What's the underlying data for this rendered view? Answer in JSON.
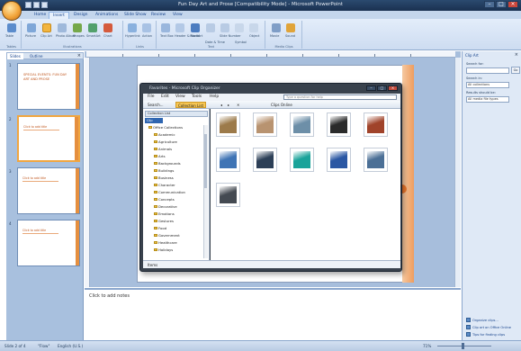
{
  "app": {
    "title": "Fun Day Art and Prose [Compatibility Mode] - Microsoft PowerPoint",
    "window_controls": [
      "–",
      "□",
      "×"
    ]
  },
  "ribbon": {
    "tabs": [
      "Home",
      "Insert",
      "Design",
      "Animations",
      "Slide Show",
      "Review",
      "View"
    ],
    "active_tab": "Insert",
    "groups": [
      {
        "name": "Tables",
        "buttons": [
          "Table"
        ]
      },
      {
        "name": "Illustrations",
        "buttons": [
          "Picture",
          "Clip Art",
          "Photo Album",
          "Shapes",
          "SmartArt",
          "Chart"
        ]
      },
      {
        "name": "Links",
        "buttons": [
          "Hyperlink",
          "Action"
        ]
      },
      {
        "name": "Text",
        "buttons": [
          "Text Box",
          "Header & Footer",
          "WordArt",
          "Date & Time",
          "Slide Number",
          "Symbol",
          "Object"
        ]
      },
      {
        "name": "Media Clips",
        "buttons": [
          "Movie",
          "Sound"
        ]
      }
    ]
  },
  "slides_pane": {
    "tabs": [
      "Slides",
      "Outline"
    ],
    "close": "×",
    "thumbnails": [
      {
        "num": "1",
        "text": "SPECIAL EVENTS: FUN DAY ART AND PROSE",
        "selected": false
      },
      {
        "num": "2",
        "text": "Click to add title",
        "selected": true
      },
      {
        "num": "3",
        "text": "Click to add title",
        "selected": false
      },
      {
        "num": "4",
        "text": "Click to add title",
        "selected": false
      }
    ]
  },
  "notes": {
    "placeholder": "Click to add notes"
  },
  "clip_organizer": {
    "title": "Favorites - Microsoft Clip Organizer",
    "menu": [
      "File",
      "Edit",
      "View",
      "Tools",
      "Help"
    ],
    "search_placeholder": "Type a question for help",
    "toolbar": [
      "Search...",
      "Collection List",
      "Clips Online"
    ],
    "tree_header": "Collection List",
    "tree_tab": "Clip",
    "tree_items": [
      "Office Collections",
      "Academic",
      "Agriculture",
      "Animals",
      "Arts",
      "Backgrounds",
      "Buildings",
      "Business",
      "Character",
      "Communication",
      "Concepts",
      "Decorative",
      "Emotions",
      "Gestures",
      "Food",
      "Government",
      "Healthcare",
      "Holidays"
    ],
    "clips": [
      {
        "name": "landmark clip",
        "color": "#9c7a4a"
      },
      {
        "name": "sculpture clip",
        "color": "#b89370"
      },
      {
        "name": "tower clip",
        "color": "#6d8fa8"
      },
      {
        "name": "dark building clip",
        "color": "#2b2b2b"
      },
      {
        "name": "pagoda clip",
        "color": "#a0432a"
      },
      {
        "name": "house clip",
        "color": "#3f74b5"
      },
      {
        "name": "lighthouse clip",
        "color": "#2c3f57"
      },
      {
        "name": "teal building clip",
        "color": "#1aa39a"
      },
      {
        "name": "blue houses clip",
        "color": "#2a57a3"
      },
      {
        "name": "city clip",
        "color": "#4b6f96"
      },
      {
        "name": "bus clip",
        "color": "#444a52"
      }
    ],
    "status": "Items",
    "window_controls": [
      "–",
      "□",
      "×"
    ]
  },
  "task_pane": {
    "title": "Clip Art",
    "close": "×",
    "search_label": "Search for:",
    "search_value": "",
    "go_label": "Go",
    "search_in_label": "Search in:",
    "search_in_value": "All collections",
    "results_label": "Results should be:",
    "results_value": "All media file types",
    "links": [
      "Organize clips...",
      "Clip art on Office Online",
      "Tips for finding clips"
    ]
  },
  "status_bar": {
    "slide": "Slide 2 of 4",
    "theme": "\"Flow\"",
    "language": "English (U.S.)",
    "zoom": "71%"
  },
  "colors": {
    "ribbon_bg": "#d7e4f5",
    "accent": "#f1a640",
    "slide_accent": "#e58f3f",
    "selection": "#f7c652"
  }
}
